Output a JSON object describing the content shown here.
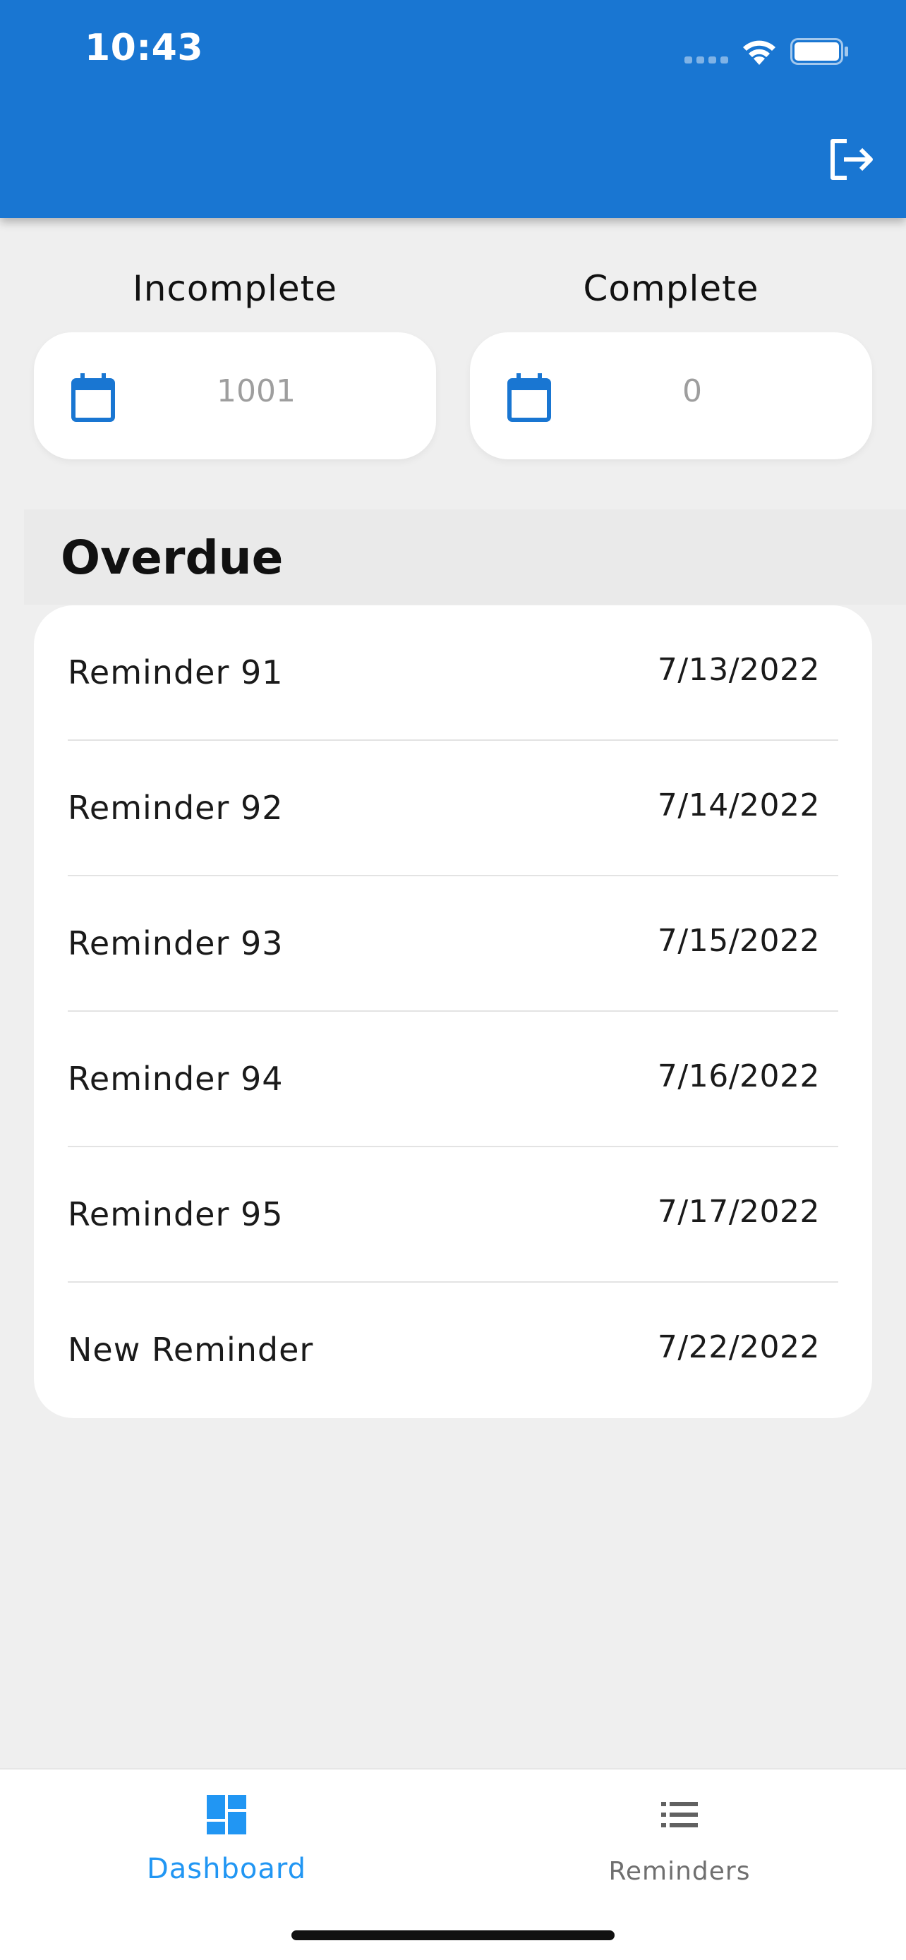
{
  "status_bar": {
    "time": "10:43"
  },
  "stats": {
    "incomplete": {
      "label": "Incomplete",
      "value": "1001"
    },
    "complete": {
      "label": "Complete",
      "value": "0"
    }
  },
  "overdue": {
    "title": "Overdue",
    "items": [
      {
        "name": "Reminder 91",
        "date": "7/13/2022"
      },
      {
        "name": "Reminder 92",
        "date": "7/14/2022"
      },
      {
        "name": "Reminder 93",
        "date": "7/15/2022"
      },
      {
        "name": "Reminder 94",
        "date": "7/16/2022"
      },
      {
        "name": "Reminder 95",
        "date": "7/17/2022"
      },
      {
        "name": "New Reminder",
        "date": "7/22/2022"
      }
    ]
  },
  "bottom_nav": {
    "dashboard_label": "Dashboard",
    "reminders_label": "Reminders",
    "active_tab": "Dashboard"
  },
  "icons": {
    "logout": "logout-icon",
    "calendar": "calendar-icon",
    "dashboard": "dashboard-icon",
    "reminders": "list-icon",
    "wifi": "wifi-icon",
    "battery": "battery-icon"
  },
  "colors": {
    "primary": "#1976d2",
    "nav_active": "#2196f3",
    "background": "#efefef"
  }
}
